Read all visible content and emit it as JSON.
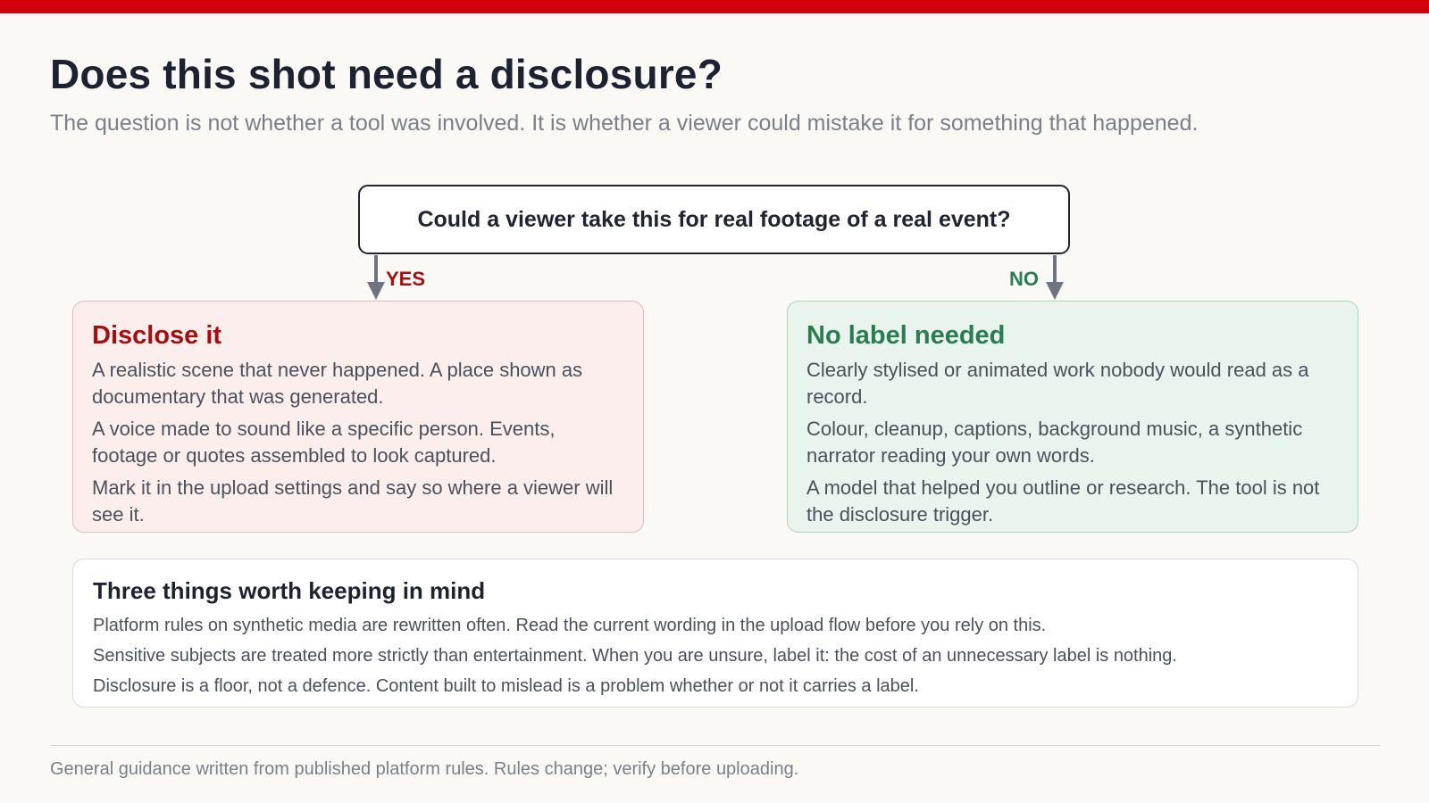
{
  "header": {
    "title": "Does this shot need a disclosure?",
    "subtitle": "The question is not whether a tool was involved. It is whether a viewer could mistake it for something that happened."
  },
  "flow": {
    "question": "Could a viewer take this for real footage of a real event?",
    "yes_label": "YES",
    "no_label": "NO",
    "yes_card": {
      "title": "Disclose it",
      "lines": [
        "A realistic scene that never happened. A place shown as documentary that was generated.",
        "A voice made to sound like a specific person. Events, footage or quotes assembled to look captured.",
        "Mark it in the upload settings and say so where a viewer will see it."
      ]
    },
    "no_card": {
      "title": "No label needed",
      "lines": [
        "Clearly stylised or animated work nobody would read as a record.",
        "Colour, cleanup, captions, background music, a synthetic narrator reading your own words.",
        "A model that helped you outline or research. The tool is not the disclosure trigger."
      ]
    }
  },
  "notes": {
    "title": "Three things worth keeping in mind",
    "items": [
      "Platform rules on synthetic media are rewritten often. Read the current wording in the upload flow before you rely on this.",
      "Sensitive subjects are treated more strictly than entertainment. When you are unsure, label it: the cost of an unnecessary label is nothing.",
      "Disclosure is a floor, not a defence. Content built to mislead is a problem whether or not it carries a label."
    ]
  },
  "footer": {
    "text": "General guidance written from published platform rules. Rules change; verify before uploading."
  },
  "colors": {
    "accent_bar": "#d0000a",
    "yes": "#a50e0e",
    "no": "#2a7d50",
    "yes_bg": "#fdeeee",
    "no_bg": "#eaf4ee"
  }
}
